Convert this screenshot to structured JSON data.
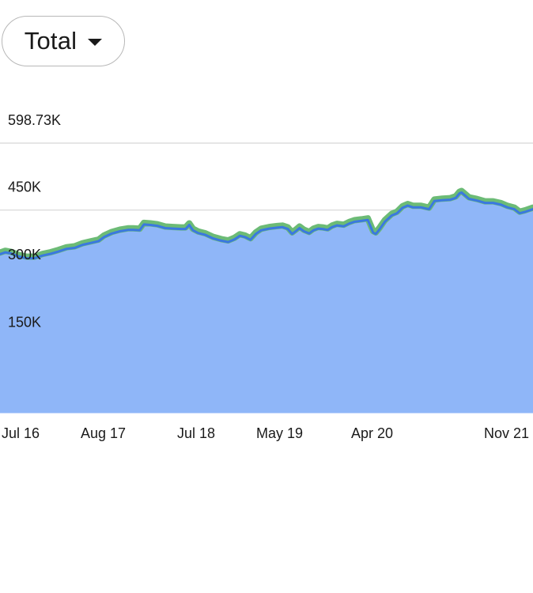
{
  "selector": {
    "value": "Total",
    "icon": "caret-down-icon"
  },
  "colors": {
    "area_fill": "#8fb6f8",
    "line_main": "#3a78e0",
    "line_highlight": "#6cbb76",
    "grid": "#d6d6d6"
  },
  "chart_data": {
    "type": "area",
    "title": "",
    "xlabel": "",
    "ylabel": "",
    "ylim": [
      0,
      598730
    ],
    "grid": true,
    "y_ticks": [
      {
        "value": 598730,
        "label": "598.73K"
      },
      {
        "value": 450000,
        "label": "450K"
      },
      {
        "value": 300000,
        "label": "300K"
      },
      {
        "value": 150000,
        "label": "150K"
      }
    ],
    "x_ticks": [
      "Jul 16",
      "Aug 17",
      "Jul 18",
      "May 19",
      "Apr 20",
      "Nov 21"
    ],
    "x_range": [
      "Jul 2016",
      "Dec 2021"
    ],
    "series": [
      {
        "values": [
          [
            0.0,
            352000
          ],
          [
            0.01,
            356000
          ],
          [
            0.02,
            354000
          ],
          [
            0.035,
            347000
          ],
          [
            0.05,
            343000
          ],
          [
            0.065,
            343000
          ],
          [
            0.08,
            349000
          ],
          [
            0.095,
            353000
          ],
          [
            0.11,
            358000
          ],
          [
            0.125,
            364000
          ],
          [
            0.14,
            366000
          ],
          [
            0.155,
            373000
          ],
          [
            0.17,
            377000
          ],
          [
            0.185,
            381000
          ],
          [
            0.195,
            390000
          ],
          [
            0.21,
            398000
          ],
          [
            0.225,
            403000
          ],
          [
            0.24,
            406000
          ],
          [
            0.25,
            406000
          ],
          [
            0.262,
            405000
          ],
          [
            0.27,
            418000
          ],
          [
            0.282,
            417000
          ],
          [
            0.295,
            415000
          ],
          [
            0.31,
            410000
          ],
          [
            0.325,
            409000
          ],
          [
            0.34,
            408000
          ],
          [
            0.348,
            408000
          ],
          [
            0.355,
            417000
          ],
          [
            0.362,
            405000
          ],
          [
            0.372,
            399000
          ],
          [
            0.385,
            395000
          ],
          [
            0.4,
            387000
          ],
          [
            0.415,
            382000
          ],
          [
            0.428,
            379000
          ],
          [
            0.44,
            385000
          ],
          [
            0.45,
            393000
          ],
          [
            0.46,
            390000
          ],
          [
            0.47,
            384000
          ],
          [
            0.48,
            397000
          ],
          [
            0.49,
            405000
          ],
          [
            0.505,
            409000
          ],
          [
            0.52,
            411000
          ],
          [
            0.53,
            412000
          ],
          [
            0.54,
            408000
          ],
          [
            0.548,
            397000
          ],
          [
            0.556,
            404000
          ],
          [
            0.562,
            410000
          ],
          [
            0.57,
            403000
          ],
          [
            0.58,
            398000
          ],
          [
            0.588,
            405000
          ],
          [
            0.597,
            409000
          ],
          [
            0.605,
            408000
          ],
          [
            0.615,
            406000
          ],
          [
            0.623,
            412000
          ],
          [
            0.632,
            416000
          ],
          [
            0.645,
            414000
          ],
          [
            0.655,
            420000
          ],
          [
            0.665,
            424000
          ],
          [
            0.678,
            426000
          ],
          [
            0.69,
            428000
          ],
          [
            0.7,
            400000
          ],
          [
            0.705,
            397000
          ],
          [
            0.712,
            407000
          ],
          [
            0.722,
            424000
          ],
          [
            0.735,
            438000
          ],
          [
            0.745,
            443000
          ],
          [
            0.755,
            455000
          ],
          [
            0.765,
            460000
          ],
          [
            0.775,
            456000
          ],
          [
            0.79,
            456000
          ],
          [
            0.805,
            452000
          ],
          [
            0.815,
            470000
          ],
          [
            0.83,
            472000
          ],
          [
            0.845,
            473000
          ],
          [
            0.855,
            477000
          ],
          [
            0.862,
            487000
          ],
          [
            0.866,
            489000
          ],
          [
            0.87,
            485000
          ],
          [
            0.88,
            475000
          ],
          [
            0.895,
            471000
          ],
          [
            0.91,
            466000
          ],
          [
            0.925,
            466000
          ],
          [
            0.94,
            462000
          ],
          [
            0.952,
            456000
          ],
          [
            0.965,
            452000
          ],
          [
            0.975,
            443000
          ],
          [
            0.985,
            446000
          ],
          [
            1.0,
            452000
          ]
        ]
      }
    ]
  }
}
